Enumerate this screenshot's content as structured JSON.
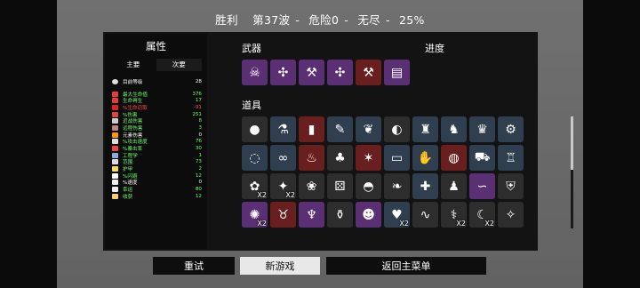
{
  "header": {
    "result": "胜利",
    "wave": "第37波",
    "danger": "危险0",
    "mode": "无尽",
    "progress": "25%"
  },
  "stats": {
    "title": "属性",
    "tabs": [
      "主要",
      "次要"
    ],
    "level": {
      "label": "目前等级",
      "value": "28"
    },
    "rows": [
      {
        "label": "最大生命值",
        "value": "376",
        "color": "#6dff6d",
        "icon": "heart-icon",
        "icon_color": "#e23d3d"
      },
      {
        "label": "生命再生",
        "value": "17",
        "color": "#6dff6d",
        "icon": "regen-icon",
        "icon_color": "#e23d3d"
      },
      {
        "label": "%生命窃取",
        "value": "-91",
        "color": "#ff4a4a",
        "icon": "drain-icon",
        "icon_color": "#d22"
      },
      {
        "label": "%伤害",
        "value": "251",
        "color": "#6dff6d",
        "icon": "damage-icon",
        "icon_color": "#d44"
      },
      {
        "label": "近战伤害",
        "value": "8",
        "color": "#6dff6d",
        "icon": "melee-icon",
        "icon_color": "#ccc"
      },
      {
        "label": "远程伤害",
        "value": "3",
        "color": "#6dff6d",
        "icon": "ranged-icon",
        "icon_color": "#b88"
      },
      {
        "label": "元素伤害",
        "value": "0",
        "color": "#ffffff",
        "icon": "elemental-icon",
        "icon_color": "#f90"
      },
      {
        "label": "%攻击速度",
        "value": "76",
        "color": "#6dff6d",
        "icon": "attack-speed-icon",
        "icon_color": "#ddd"
      },
      {
        "label": "%暴击率",
        "value": "30",
        "color": "#6dff6d",
        "icon": "crit-icon",
        "icon_color": "#e44"
      },
      {
        "label": "工程学",
        "value": "1",
        "color": "#6dff6d",
        "icon": "engineering-icon",
        "icon_color": "#8ad"
      },
      {
        "label": "范围",
        "value": "73",
        "color": "#6dff6d",
        "icon": "range-icon",
        "icon_color": "#ddd"
      },
      {
        "label": "护甲",
        "value": "2",
        "color": "#6dff6d",
        "icon": "armor-icon",
        "icon_color": "#fd4"
      },
      {
        "label": "%闪避",
        "value": "12",
        "color": "#6dff6d",
        "icon": "dodge-icon",
        "icon_color": "#fff"
      },
      {
        "label": "%速度",
        "value": "0",
        "color": "#ffffff",
        "icon": "speed-icon",
        "icon_color": "#eee"
      },
      {
        "label": "幸运",
        "value": "80",
        "color": "#6dff6d",
        "icon": "luck-icon",
        "icon_color": "#eee"
      },
      {
        "label": "收获",
        "value": "12",
        "color": "#6dff6d",
        "icon": "harvest-icon",
        "icon_color": "#fc6"
      }
    ]
  },
  "weapons": {
    "label": "武器",
    "progress_label": "进度",
    "slots": [
      {
        "icon": "skull-staff-icon",
        "glyph": "☠",
        "bg": "#5b2f73"
      },
      {
        "icon": "crossbow-icon",
        "glyph": "✣",
        "bg": "#5b2f73"
      },
      {
        "icon": "hammer-icon",
        "glyph": "⚒",
        "bg": "#5b2f73"
      },
      {
        "icon": "crossbow-icon",
        "glyph": "✣",
        "bg": "#5b2f73"
      },
      {
        "icon": "hammer-icon",
        "glyph": "⚒",
        "bg": "#6a1f1f"
      },
      {
        "icon": "minigun-icon",
        "glyph": "▤",
        "bg": "#5b2f73"
      }
    ]
  },
  "items": {
    "label": "道具",
    "slots": [
      {
        "icon": "egg-icon",
        "glyph": "●",
        "bg": "#2d2d2d",
        "qty": ""
      },
      {
        "icon": "potion-icon",
        "glyph": "⚗",
        "bg": "#2f3f4f",
        "qty": ""
      },
      {
        "icon": "vial-icon",
        "glyph": "▮",
        "bg": "#6a1f1f",
        "qty": ""
      },
      {
        "icon": "syringe-icon",
        "glyph": "✎",
        "bg": "#2f3f4f",
        "qty": ""
      },
      {
        "icon": "butterfly-icon",
        "glyph": "❦",
        "bg": "#2f3f4f",
        "qty": ""
      },
      {
        "icon": "snail-icon",
        "glyph": "◐",
        "bg": "#2d2d2d",
        "qty": ""
      },
      {
        "icon": "robot-icon",
        "glyph": "♜",
        "bg": "#2f3f4f",
        "qty": ""
      },
      {
        "icon": "bird-icon",
        "glyph": "♞",
        "bg": "#2f3f4f",
        "qty": ""
      },
      {
        "icon": "crown-icon",
        "glyph": "♛",
        "bg": "#2f3f4f",
        "qty": ""
      },
      {
        "icon": "machine-icon",
        "glyph": "⚙",
        "bg": "#2f3f4f",
        "qty": ""
      },
      {
        "icon": "necklace-icon",
        "glyph": "◌",
        "bg": "#2f3f4f",
        "qty": ""
      },
      {
        "icon": "glasses-icon",
        "glyph": "∞",
        "bg": "#2f3f4f",
        "qty": ""
      },
      {
        "icon": "cape-icon",
        "glyph": "♨",
        "bg": "#6a1f1f",
        "qty": ""
      },
      {
        "icon": "cake-icon",
        "glyph": "♣",
        "bg": "#2d2d2d",
        "qty": ""
      },
      {
        "icon": "claw-icon",
        "glyph": "✶",
        "bg": "#6a1f1f",
        "qty": ""
      },
      {
        "icon": "brick-icon",
        "glyph": "▭",
        "bg": "#2f3f4f",
        "qty": ""
      },
      {
        "icon": "glove-icon",
        "glyph": "✋",
        "bg": "#2f3f4f",
        "qty": ""
      },
      {
        "icon": "pod-icon",
        "glyph": "◍",
        "bg": "#6a1f1f",
        "qty": ""
      },
      {
        "icon": "wheelbarrow-icon",
        "glyph": "⛟",
        "bg": "#2f3f4f",
        "qty": ""
      },
      {
        "icon": "turret-icon",
        "glyph": "♖",
        "bg": "#2f3f4f",
        "qty": ""
      },
      {
        "icon": "potato-icon",
        "glyph": "✿",
        "bg": "#2d2d2d",
        "qty": "X2"
      },
      {
        "icon": "ninja-icon",
        "glyph": "✦",
        "bg": "#2d2d2d",
        "qty": "X2"
      },
      {
        "icon": "dog-icon",
        "glyph": "❀",
        "bg": "#2d2d2d",
        "qty": ""
      },
      {
        "icon": "dice-icon",
        "glyph": "⚄",
        "bg": "#2d2d2d",
        "qty": ""
      },
      {
        "icon": "helmet-icon",
        "glyph": "◓",
        "bg": "#2d2d2d",
        "qty": ""
      },
      {
        "icon": "bush-icon",
        "glyph": "❧",
        "bg": "#2d2d2d",
        "qty": ""
      },
      {
        "icon": "medkit-icon",
        "glyph": "✚",
        "bg": "#2f3f4f",
        "qty": ""
      },
      {
        "icon": "penguin-icon",
        "glyph": "♟",
        "bg": "#2d2d2d",
        "qty": ""
      },
      {
        "icon": "worm-icon",
        "glyph": "∽",
        "bg": "#5b2f73",
        "qty": ""
      },
      {
        "icon": "knight-helm-icon",
        "glyph": "⛨",
        "bg": "#2d2d2d",
        "qty": ""
      },
      {
        "icon": "bat-icon",
        "glyph": "✺",
        "bg": "#5b2f73",
        "qty": "X2"
      },
      {
        "icon": "mammoth-icon",
        "glyph": "♉",
        "bg": "#6a1f1f",
        "qty": ""
      },
      {
        "icon": "squid-icon",
        "glyph": "♆",
        "bg": "#5b2f73",
        "qty": ""
      },
      {
        "icon": "bottle-icon",
        "glyph": "⚱",
        "bg": "#2d2d2d",
        "qty": ""
      },
      {
        "icon": "blob-icon",
        "glyph": "☻",
        "bg": "#5b2f73",
        "qty": ""
      },
      {
        "icon": "slime-icon",
        "glyph": "♥",
        "bg": "#2f3f4f",
        "qty": "X2"
      },
      {
        "icon": "scarf-icon",
        "glyph": "∿",
        "bg": "#2d2d2d",
        "qty": ""
      },
      {
        "icon": "bone-icon",
        "glyph": "⚕",
        "bg": "#2d2d2d",
        "qty": "X2"
      },
      {
        "icon": "scythe-icon",
        "glyph": "☾",
        "bg": "#2d2d2d",
        "qty": "X2"
      },
      {
        "icon": "axe-icon",
        "glyph": "✧",
        "bg": "#2d2d2d",
        "qty": ""
      }
    ]
  },
  "buttons": {
    "retry": "重试",
    "new_game": "新游戏",
    "main_menu": "返回主菜单"
  }
}
